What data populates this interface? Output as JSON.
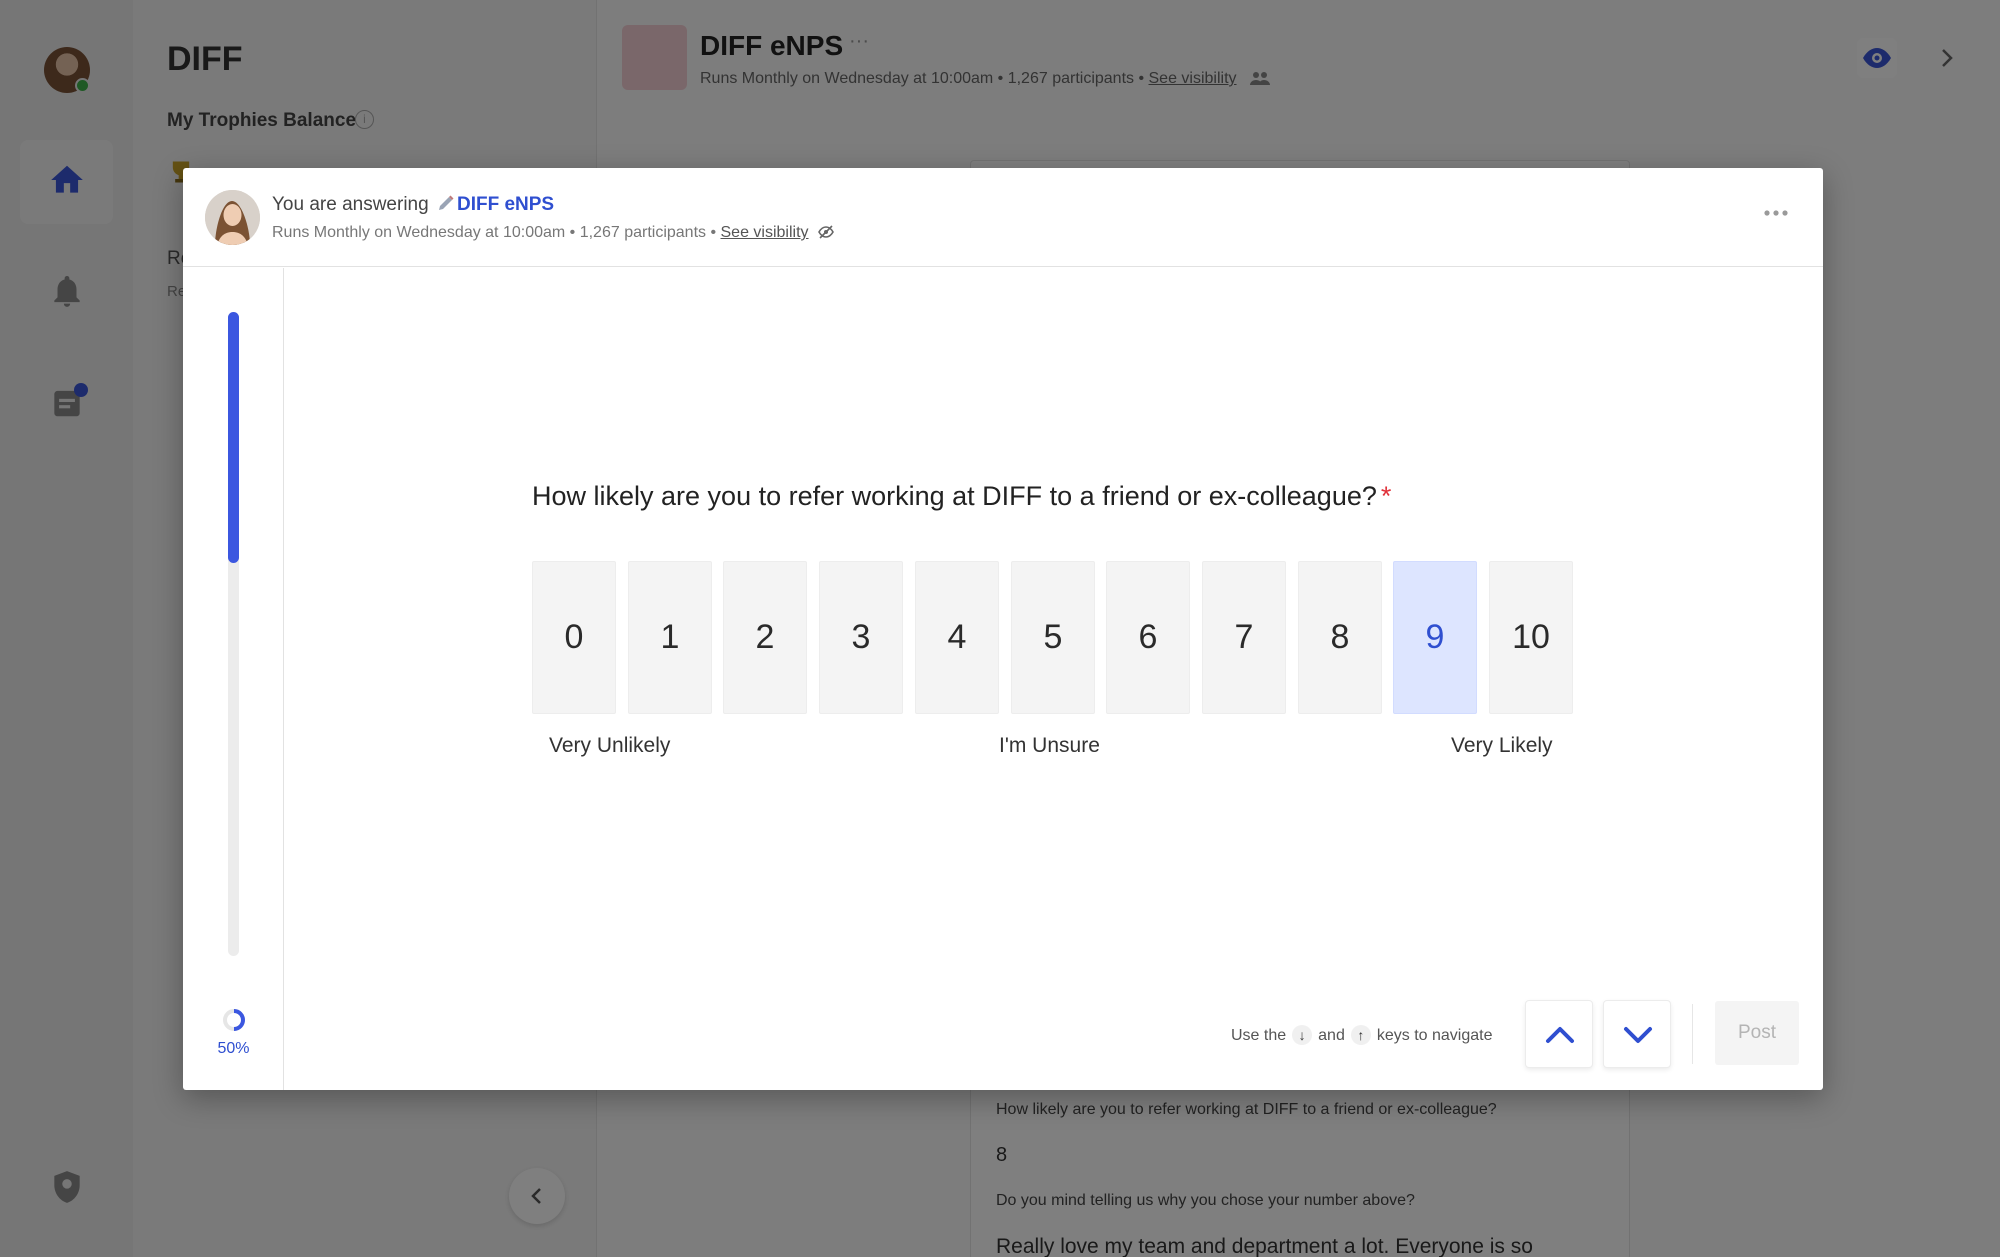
{
  "app": {
    "org_name": "DIFF",
    "trophies_label": "My Trophies Balance",
    "sidebar_snippet_1": "Re",
    "sidebar_snippet_2": "Re"
  },
  "background_post": {
    "title": "DIFF eNPS",
    "more": "···",
    "subtitle_prefix": "Runs Monthly on Wednesday at 10:00am • 1,267 participants • ",
    "visibility_link": "See visibility",
    "question_1": "How likely are you to refer working at DIFF to a friend or ex-colleague?",
    "answer_1": "8",
    "question_2": "Do you mind telling us why you chose your number above?",
    "answer_2": "Really love my team and department a lot. Everyone is so"
  },
  "modal": {
    "header": {
      "answering_prefix": "You are answering",
      "survey_name": "DIFF eNPS",
      "subtitle_prefix": "Runs Monthly on Wednesday at 10:00am • 1,267 participants • ",
      "visibility_link": "See visibility"
    },
    "progress": {
      "percent": 50,
      "label": "50%"
    },
    "question": {
      "text": "How likely are you to refer working at DIFF to a friend or ex-colleague?",
      "required_mark": "*"
    },
    "scale": {
      "options": [
        "0",
        "1",
        "2",
        "3",
        "4",
        "5",
        "6",
        "7",
        "8",
        "9",
        "10"
      ],
      "selected": "9",
      "label_low": "Very Unlikely",
      "label_mid": "I'm Unsure",
      "label_high": "Very Likely"
    },
    "footer": {
      "hint_prefix": "Use the",
      "hint_key_down": "↓",
      "hint_and": "and",
      "hint_key_up": "↑",
      "hint_suffix": "keys to navigate",
      "post_label": "Post"
    }
  },
  "colors": {
    "accent": "#2f4fd0",
    "progress_fill": "#3b57e0",
    "selected_bg": "#dde5ff",
    "required": "#e0313a"
  },
  "icons": [
    "home-icon",
    "bell-icon",
    "tasks-icon",
    "admin-shield-icon",
    "info-icon",
    "trophy-icon",
    "eye-icon",
    "eye-off-icon",
    "pencil-icon",
    "people-icon",
    "chevron-up-icon",
    "chevron-down-icon",
    "chevron-left-icon",
    "chevron-right-icon",
    "more-icon",
    "spinner-icon"
  ]
}
